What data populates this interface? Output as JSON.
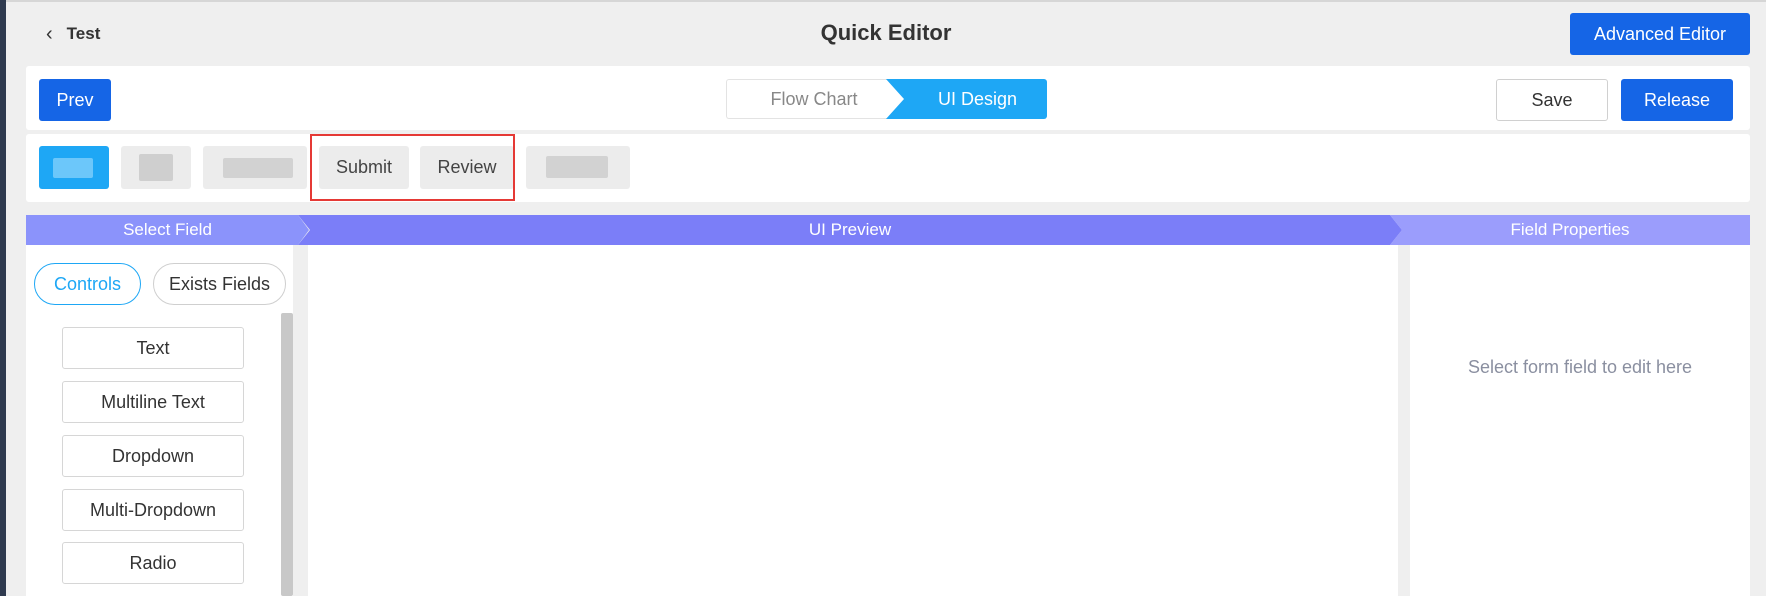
{
  "header": {
    "back_label": "Test",
    "title": "Quick Editor",
    "advanced_editor_label": "Advanced Editor"
  },
  "toolbar": {
    "prev_label": "Prev",
    "steps": [
      {
        "label": "Flow Chart",
        "active": false
      },
      {
        "label": "UI Design",
        "active": true
      }
    ],
    "save_label": "Save",
    "release_label": "Release"
  },
  "nodes": {
    "submit_label": "Submit",
    "review_label": "Review"
  },
  "panels": {
    "select_field_title": "Select Field",
    "ui_preview_title": "UI Preview",
    "field_properties_title": "Field Properties",
    "tabs": [
      {
        "label": "Controls",
        "active": true
      },
      {
        "label": "Exists Fields",
        "active": false
      }
    ],
    "controls": [
      "Text",
      "Multiline Text",
      "Dropdown",
      "Multi-Dropdown",
      "Radio"
    ],
    "properties_hint": "Select form field to edit here"
  },
  "colors": {
    "primary": "#1565e6",
    "accent": "#1ea7f5",
    "panel_header": "#7b7ef8",
    "highlight_border": "#e53935"
  }
}
